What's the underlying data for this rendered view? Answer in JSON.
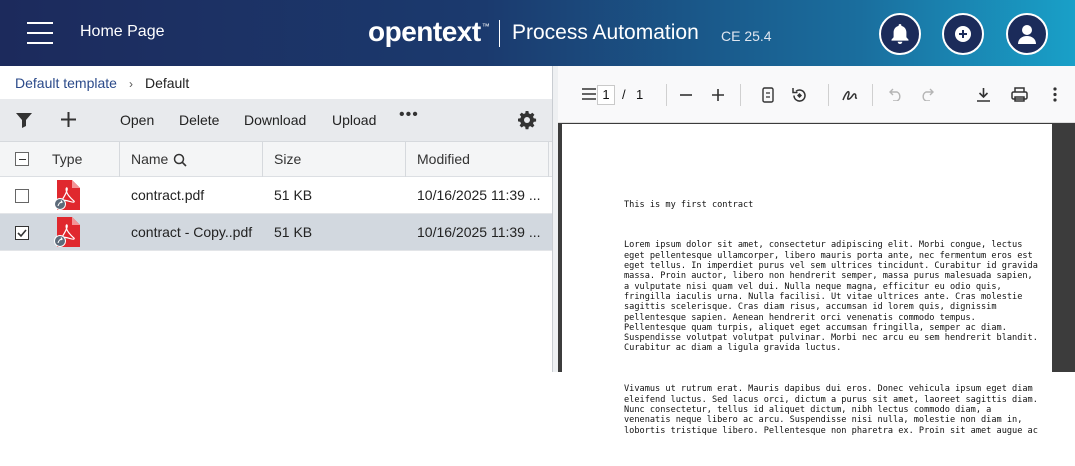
{
  "header": {
    "home_title": "Home Page",
    "brand": "opentext",
    "brand_tm": "™",
    "product": "Process Automation",
    "version": "CE 25.4"
  },
  "breadcrumb": {
    "parent": "Default template",
    "separator": "›",
    "current": "Default"
  },
  "toolbar": {
    "open": "Open",
    "delete": "Delete",
    "download": "Download",
    "upload": "Upload",
    "more": "•••"
  },
  "table": {
    "columns": [
      "Type",
      "Name",
      "Size",
      "Modified"
    ],
    "rows": [
      {
        "name": "contract.pdf",
        "size": "51 KB",
        "modified": "10/16/2025 11:39 ...",
        "selected": false
      },
      {
        "name": "contract - Copy..pdf",
        "size": "51 KB",
        "modified": "10/16/2025 11:39 ...",
        "selected": true
      }
    ]
  },
  "viewer": {
    "page_current": "1",
    "page_total": "1",
    "page_sep": "/",
    "doc_title": "This is my first contract",
    "para1": "Lorem ipsum dolor sit amet, consectetur adipiscing elit. Morbi congue, lectus\neget pellentesque ullamcorper, libero mauris porta ante, nec fermentum eros est\neget tellus. In imperdiet purus vel sem ultrices tincidunt. Curabitur id gravida\nmassa. Proin auctor, libero non hendrerit semper, massa purus malesuada sapien,\na vulputate nisi quam vel dui. Nulla neque magna, efficitur eu odio quis,\nfringilla iaculis urna. Nulla facilisi. Ut vitae ultrices ante. Cras molestie\nsagittis scelerisque. Cras diam risus, accumsan id lorem quis, dignissim\npellentesque sapien. Aenean hendrerit orci venenatis commodo tempus.\nPellentesque quam turpis, aliquet eget accumsan fringilla, semper ac diam.\nSuspendisse volutpat volutpat pulvinar. Morbi nec arcu eu sem hendrerit blandit.\nCurabitur ac diam a ligula gravida luctus.",
    "para2": "Vivamus ut rutrum erat. Mauris dapibus dui eros. Donec vehicula ipsum eget diam\neleifend luctus. Sed lacus orci, dictum a purus sit amet, laoreet sagittis diam.\nNunc consectetur, tellus id aliquet dictum, nibh lectus commodo diam, a\nvenenatis neque libero ac arcu. Suspendisse nisi nulla, molestie non diam in,\nlobortis tristique libero. Pellentesque non pharetra ex. Proin sit amet augue ac"
  },
  "colors": {
    "header_start": "#1c2a5c",
    "header_end": "#19a0c8",
    "pdf_icon": "#e0282e",
    "selected_row": "#d2d8df"
  }
}
